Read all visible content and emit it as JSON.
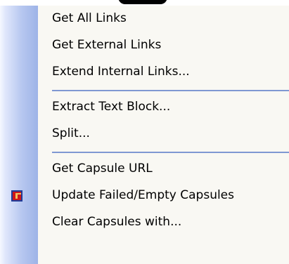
{
  "menu": {
    "items": [
      {
        "label": "Get All Links"
      },
      {
        "label": "Get External Links"
      },
      {
        "label": "Extend Internal Links..."
      },
      {
        "label": "Extract Text Block..."
      },
      {
        "label": "Split..."
      },
      {
        "label": "Get Capsule URL"
      },
      {
        "label": "Update Failed/Empty Capsules",
        "icon": "capsule-icon"
      },
      {
        "label": "Clear Capsules with..."
      }
    ]
  },
  "colors": {
    "menu_background": "#f9f8f3",
    "gutter_blue": "#9db3e7",
    "separator": "#7f98d2",
    "icon_red": "#d01818",
    "icon_blue": "#1f3a98"
  }
}
